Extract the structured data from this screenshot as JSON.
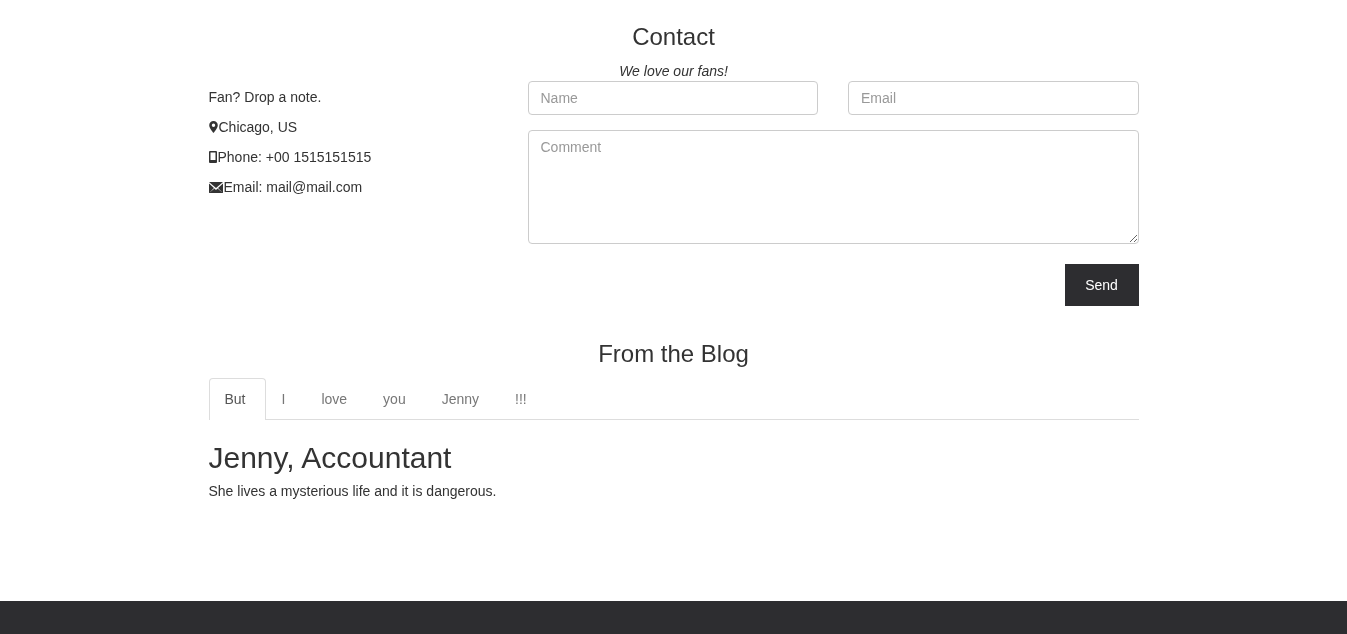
{
  "contact": {
    "title": "Contact",
    "subtitle": "We love our fans!",
    "info": [
      {
        "kind": "text",
        "text": "Fan? Drop a note."
      },
      {
        "kind": "location",
        "text": "Chicago, US"
      },
      {
        "kind": "phone",
        "text": "Phone: +00 1515151515"
      },
      {
        "kind": "email",
        "text": "Email: mail@mail.com"
      }
    ],
    "form": {
      "name": {
        "placeholder": "Name"
      },
      "email": {
        "placeholder": "Email"
      },
      "comment": {
        "placeholder": "Comment"
      },
      "button": "Send"
    }
  },
  "blog": {
    "title": "From the Blog",
    "tabs": [
      {
        "label": "But",
        "selected": true
      },
      {
        "label": "I",
        "selected": false
      },
      {
        "label": "love",
        "selected": false
      },
      {
        "label": "you",
        "selected": false
      },
      {
        "label": "Jenny",
        "selected": false
      },
      {
        "label": "!!!",
        "selected": false
      }
    ],
    "heading": "Jenny, Accountant",
    "text": "She lives a mysterious life and it is dangerous."
  }
}
